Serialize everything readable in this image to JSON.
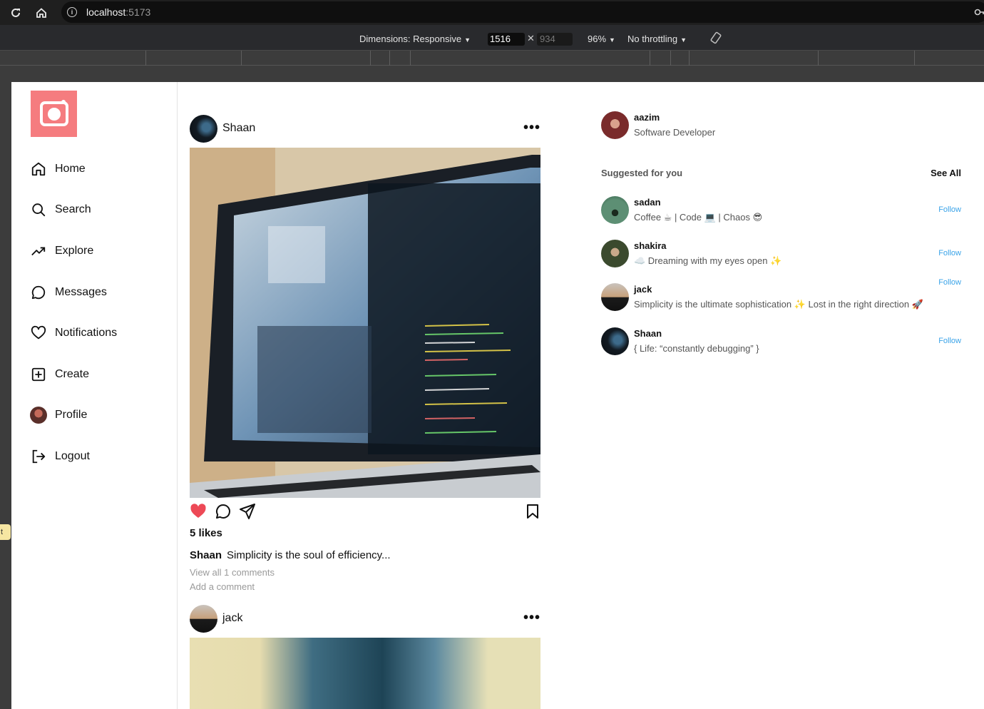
{
  "browser": {
    "host": "localhost",
    "port": ":5173",
    "dimensions_label": "Dimensions: Responsive",
    "width": "1516",
    "height": "934",
    "zoom": "96%",
    "throttling": "No throttling"
  },
  "gutter_tab": "t",
  "sidebar": {
    "items": [
      {
        "label": "Home",
        "icon": "home-icon"
      },
      {
        "label": "Search",
        "icon": "search-icon"
      },
      {
        "label": "Explore",
        "icon": "trending-icon"
      },
      {
        "label": "Messages",
        "icon": "message-icon"
      },
      {
        "label": "Notifications",
        "icon": "heart-icon"
      },
      {
        "label": "Create",
        "icon": "plus-square-icon"
      },
      {
        "label": "Profile",
        "icon": "avatar"
      },
      {
        "label": "Logout",
        "icon": "logout-icon"
      }
    ]
  },
  "feed": {
    "posts": [
      {
        "user": "Shaan",
        "likes": "5 likes",
        "caption_user": "Shaan",
        "caption": "Simplicity is the soul of efficiency...",
        "view_all": "View all 1 comments",
        "add_comment": "Add a comment"
      },
      {
        "user": "jack"
      }
    ]
  },
  "current_user": {
    "username": "aazim",
    "bio": "Software Developer"
  },
  "suggestions": {
    "title": "Suggested for you",
    "see_all": "See All",
    "follow_label": "Follow",
    "users": [
      {
        "username": "sadan",
        "bio": "Coffee ☕ | Code 💻 | Chaos 😎"
      },
      {
        "username": "shakira",
        "bio": "☁️ Dreaming with my eyes open ✨"
      },
      {
        "username": "jack",
        "bio": "Simplicity is the ultimate sophistication ✨ Lost in the right direction 🚀"
      },
      {
        "username": "Shaan",
        "bio": "{ Life: “constantly debugging” }"
      }
    ]
  },
  "colors": {
    "logo_bg": "#f57c7f",
    "like": "#ed4956",
    "follow": "#3aa3e8"
  }
}
